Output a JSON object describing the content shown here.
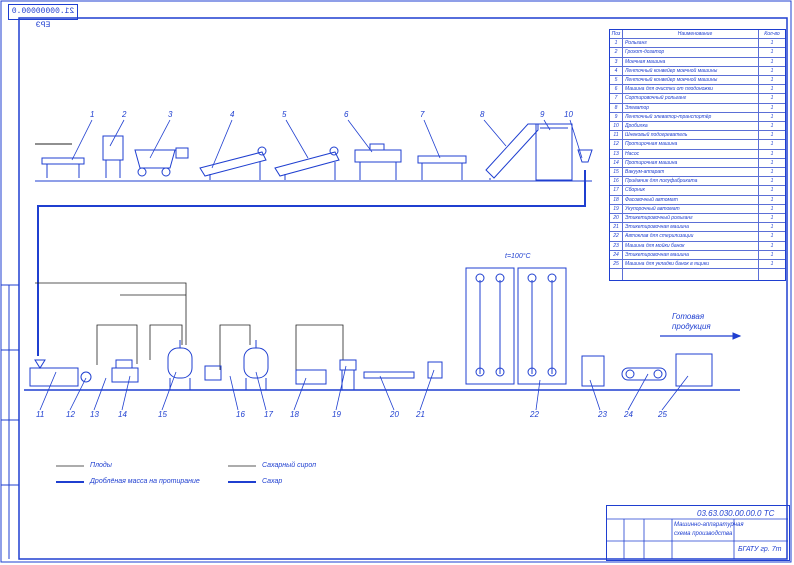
{
  "stamp": "21.00000000.0 ЕРЭ",
  "spec_table": {
    "headers": {
      "pos": "Поз",
      "name": "Наименование",
      "qty": "Кол-во"
    },
    "rows": [
      {
        "pos": "1",
        "name": "Рольганг",
        "qty": "1"
      },
      {
        "pos": "2",
        "name": "Грохот-дозатор",
        "qty": "1"
      },
      {
        "pos": "3",
        "name": "Моечная машина",
        "qty": "1"
      },
      {
        "pos": "4",
        "name": "Ленточный конвейер моечной машины",
        "qty": "1"
      },
      {
        "pos": "5",
        "name": "Ленточный конвейер моечной машины",
        "qty": "1"
      },
      {
        "pos": "6",
        "name": "Машина для очистки от плодоножки",
        "qty": "1"
      },
      {
        "pos": "7",
        "name": "Сортировочный рольганг",
        "qty": "1"
      },
      {
        "pos": "8",
        "name": "Элеватор",
        "qty": "1"
      },
      {
        "pos": "9",
        "name": "Ленточный элеватор-транспортёр",
        "qty": "1"
      },
      {
        "pos": "10",
        "name": "Дробилка",
        "qty": "1"
      },
      {
        "pos": "11",
        "name": "Шнековый подогреватель",
        "qty": "1"
      },
      {
        "pos": "12",
        "name": "Протирочная машина",
        "qty": "1"
      },
      {
        "pos": "13",
        "name": "Насос",
        "qty": "1"
      },
      {
        "pos": "14",
        "name": "Протирочная машина",
        "qty": "1"
      },
      {
        "pos": "15",
        "name": "Вакуум-аппарат",
        "qty": "1"
      },
      {
        "pos": "16",
        "name": "Приёмник для полуфабриката",
        "qty": "1"
      },
      {
        "pos": "17",
        "name": "Сборник",
        "qty": "1"
      },
      {
        "pos": "18",
        "name": "Фасовочный автомат",
        "qty": "1"
      },
      {
        "pos": "19",
        "name": "Укупорочный автомат",
        "qty": "1"
      },
      {
        "pos": "20",
        "name": "Этикетировочный рольганг",
        "qty": "1"
      },
      {
        "pos": "21",
        "name": "Этикетировочная машина",
        "qty": "1"
      },
      {
        "pos": "22",
        "name": "Автоклав для стерилизации",
        "qty": "1"
      },
      {
        "pos": "23",
        "name": "Машина для мойки банок",
        "qty": "1"
      },
      {
        "pos": "24",
        "name": "Этикетировочная машина",
        "qty": "1"
      },
      {
        "pos": "25",
        "name": "Машина для укладки банок в ящики",
        "qty": "1"
      }
    ]
  },
  "labels": {
    "temperature": "t=100°C",
    "output_line1": "Готовая",
    "output_line2": "продукция"
  },
  "legend": [
    {
      "text": "Плоды",
      "style": "thin"
    },
    {
      "text": "Сахарный сироп",
      "style": "thin"
    },
    {
      "text": "Дроблёная масса на протирание",
      "style": "thick"
    },
    {
      "text": "Сахар",
      "style": "thick"
    }
  ],
  "title_block": {
    "code": "03.63.030.00.00.0 ТС",
    "name_line1": "Машинно-аппаратурная",
    "name_line2": "схема производства",
    "org": "БГАТУ гр. 7т"
  },
  "colors": {
    "line": "#1f3fd0"
  }
}
